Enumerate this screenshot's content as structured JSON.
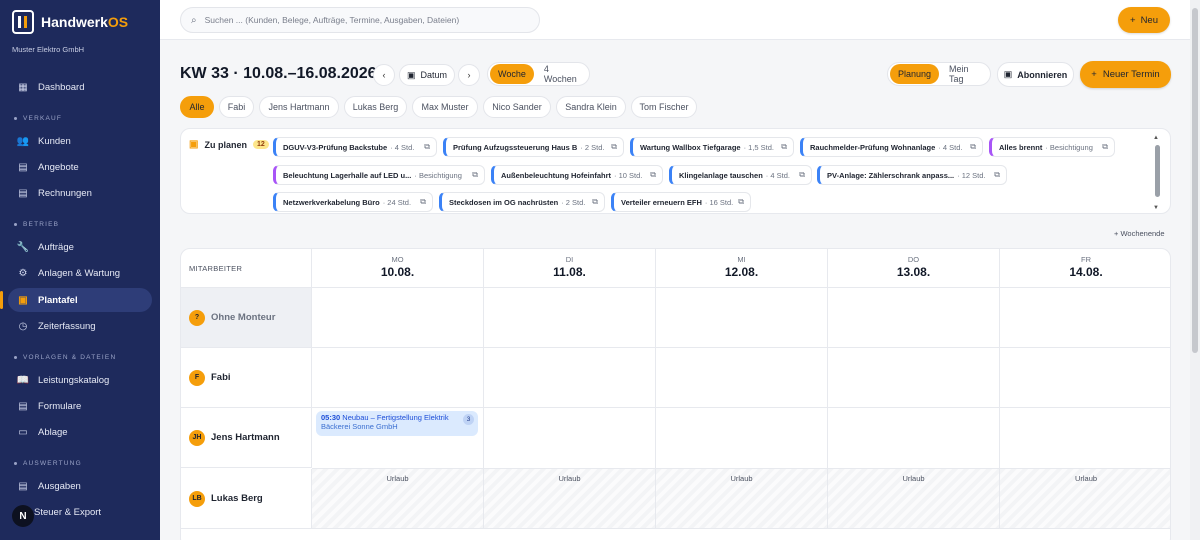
{
  "brand": {
    "name_main": "Handwerk",
    "name_accent": "OS",
    "company": "Muster Elektro GmbH"
  },
  "nav": {
    "dashboard": "Dashboard",
    "sec_verkauf": "VERKAUF",
    "kunden": "Kunden",
    "angebote": "Angebote",
    "rechnungen": "Rechnungen",
    "sec_betrieb": "BETRIEB",
    "auftraege": "Aufträge",
    "anlagen": "Anlagen & Wartung",
    "plantafel": "Plantafel",
    "zeiterfassung": "Zeiterfassung",
    "sec_vorlagen": "VORLAGEN & DATEIEN",
    "leistungskatalog": "Leistungskatalog",
    "formulare": "Formulare",
    "ablage": "Ablage",
    "sec_auswertung": "AUSWERTUNG",
    "ausgaben": "Ausgaben",
    "steuer": "Steuer & Export"
  },
  "user_initial": "N",
  "search": {
    "placeholder": "Suchen ... (Kunden, Belege, Aufträge, Termine, Ausgaben, Dateien)"
  },
  "topbar": {
    "new_label": "Neu"
  },
  "header": {
    "week_title": "KW 33 · 10.08.–16.08.2026",
    "datum_label": "Datum",
    "view_woche": "Woche",
    "view_4wochen": "4 Wochen",
    "mode_planung": "Planung",
    "mode_meintag": "Mein Tag",
    "abonnieren_label": "Abonnieren",
    "neuer_termin_label": "Neuer Termin"
  },
  "filters": [
    "Alle",
    "Fabi",
    "Jens Hartmann",
    "Lukas Berg",
    "Max Muster",
    "Nico Sander",
    "Sandra Klein",
    "Tom Fischer"
  ],
  "planen": {
    "label": "Zu planen",
    "count": "12",
    "items": [
      {
        "title": "DGUV-V3-Prüfung Backstube",
        "meta": "· 4 Std."
      },
      {
        "title": "Prüfung Aufzugssteuerung Haus B",
        "meta": "· 2 Std."
      },
      {
        "title": "Wartung Wallbox Tiefgarage",
        "meta": "· 1,5 Std."
      },
      {
        "title": "Rauchmelder-Prüfung Wohnanlage",
        "meta": "· 4 Std."
      },
      {
        "title": "Alles brennt",
        "meta": "· Besichtigung"
      },
      {
        "title": "Beleuchtung Lagerhalle auf LED u...",
        "meta": "· Besichtigung"
      },
      {
        "title": "Außenbeleuchtung Hofeinfahrt",
        "meta": "· 10 Std."
      },
      {
        "title": "Klingelanlage tauschen",
        "meta": "· 4 Std."
      },
      {
        "title": "PV-Anlage: Zählerschrank anpass...",
        "meta": "· 12 Std."
      },
      {
        "title": "Netzwerkverkabelung Büro",
        "meta": "· 24 Std."
      },
      {
        "title": "Steckdosen im OG nachrüsten",
        "meta": "· 2 Std."
      },
      {
        "title": "Verteiler erneuern EFH",
        "meta": "· 16 Std."
      }
    ]
  },
  "wochenende_label": "+ Wochenende",
  "grid": {
    "mitarbeiter_header": "MITARBEITER",
    "days": [
      {
        "d": "MO",
        "date": "10.08."
      },
      {
        "d": "DI",
        "date": "11.08."
      },
      {
        "d": "MI",
        "date": "12.08."
      },
      {
        "d": "DO",
        "date": "13.08."
      },
      {
        "d": "FR",
        "date": "14.08."
      }
    ],
    "rows": [
      {
        "initials": "?",
        "name": "Ohne Monteur"
      },
      {
        "initials": "F",
        "name": "Fabi"
      },
      {
        "initials": "JH",
        "name": "Jens Hartmann"
      },
      {
        "initials": "LB",
        "name": "Lukas Berg"
      }
    ],
    "urlaub_label": "Urlaub",
    "event": {
      "time": "05:30",
      "title": "Neubau – Fertigstellung Elektrik",
      "customer": "Bäckerei Sonne GmbH",
      "badge": "3"
    }
  },
  "colors": {
    "accent": "#f59e0b",
    "sidebar": "#1e2a5c",
    "event_bg": "#dbeafe"
  }
}
